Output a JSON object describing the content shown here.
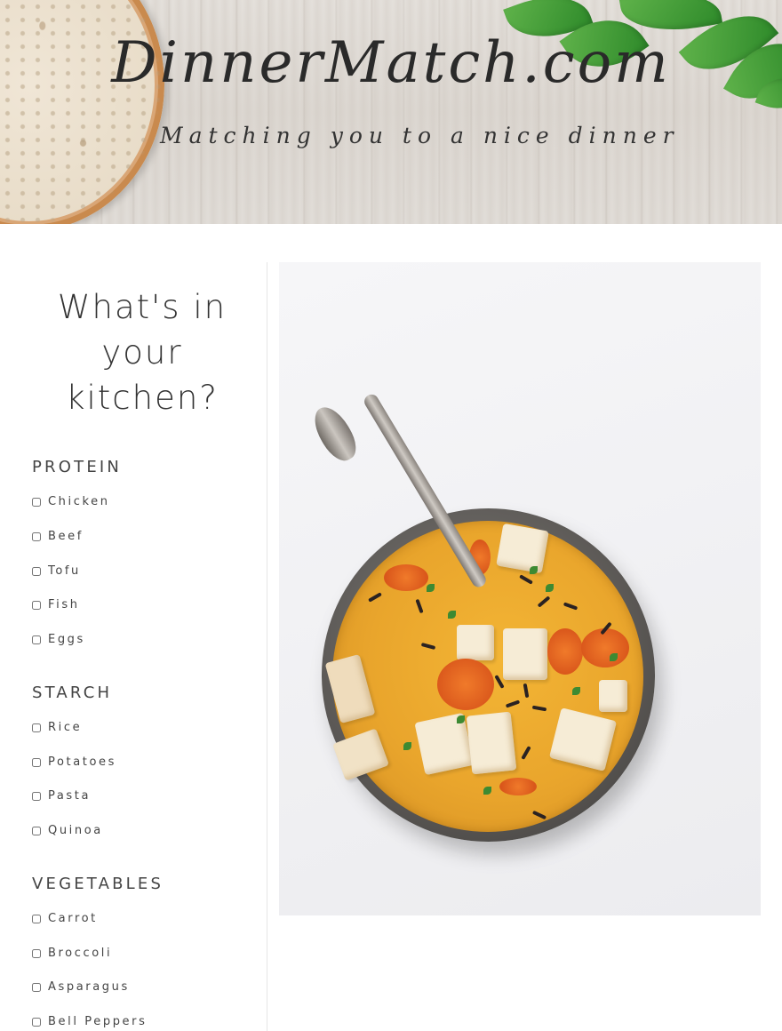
{
  "header": {
    "brand": "DinnerMatch.com",
    "tagline": "Matching you to a nice dinner"
  },
  "sidebar": {
    "heading": "What's in your kitchen?",
    "sections": [
      {
        "title": "PROTEIN",
        "options": [
          "Chicken",
          "Beef",
          "Tofu",
          "Fish",
          "Eggs"
        ]
      },
      {
        "title": "STARCH",
        "options": [
          "Rice",
          "Potatoes",
          "Pasta",
          "Quinoa"
        ]
      },
      {
        "title": "VEGETABLES",
        "options": [
          "Carrot",
          "Broccoli",
          "Asparagus",
          "Bell Peppers"
        ]
      }
    ]
  },
  "colors": {
    "text": "#333333",
    "divider": "#e6e6e6",
    "wood": "#dcd7d1",
    "stew": "#e9a52c"
  }
}
